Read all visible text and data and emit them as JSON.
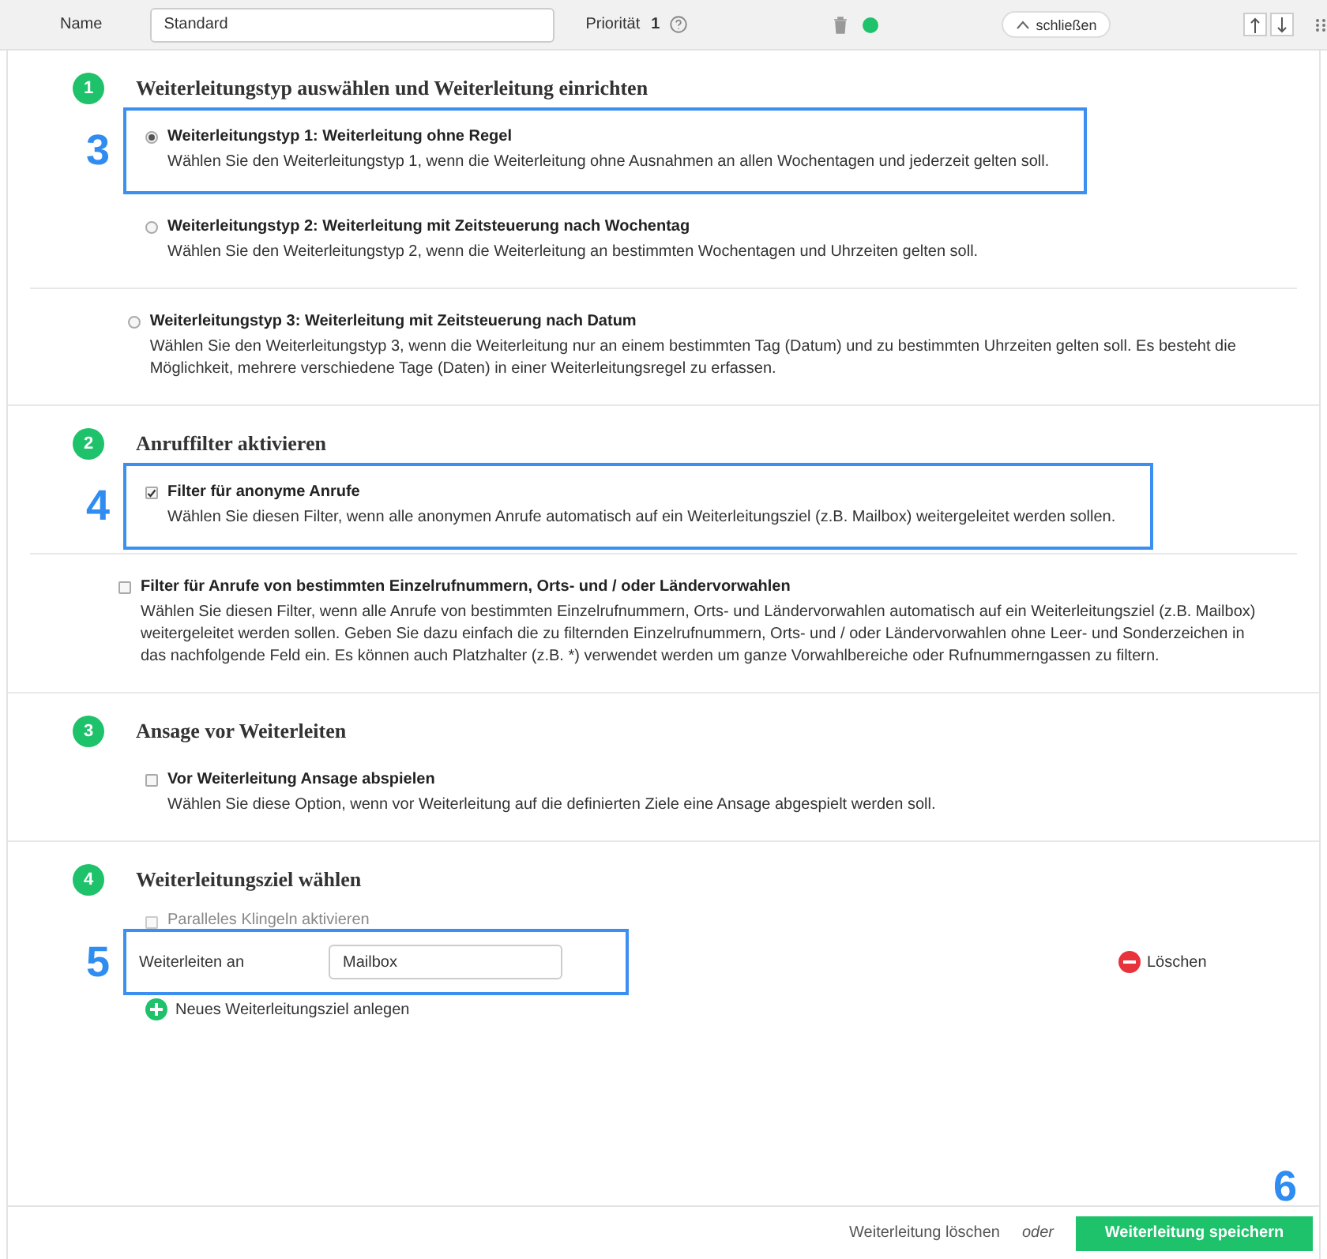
{
  "header": {
    "name_label": "Name",
    "name_value": "Standard",
    "priority_label": "Priorität",
    "priority_value": "1",
    "active": true,
    "close_label": "schließen"
  },
  "sections": [
    {
      "number": "1",
      "title": "Weiterleitungstyp auswählen und Weiterleitung einrichten",
      "options": [
        {
          "kind": "radio",
          "selected": true,
          "divider_above": false,
          "callout": "3",
          "title": "Weiterleitungstyp 1: Weiterleitung ohne Regel",
          "description": "Wählen Sie den Weiterleitungstyp 1, wenn die Weiterleitung ohne Ausnahmen an allen Wochentagen und jederzeit gelten soll."
        },
        {
          "kind": "radio",
          "selected": false,
          "divider_above": false,
          "title": "Weiterleitungstyp 2: Weiterleitung mit Zeitsteuerung nach Wochentag",
          "description": "Wählen Sie den Weiterleitungstyp 2, wenn die Weiterleitung an bestimmten Wochentagen und Uhrzeiten gelten soll."
        },
        {
          "kind": "radio",
          "selected": false,
          "divider_above": true,
          "title": "Weiterleitungstyp 3: Weiterleitung mit Zeitsteuerung nach Datum",
          "description": "Wählen Sie den Weiterleitungstyp 3, wenn die Weiterleitung nur an einem bestimmten Tag (Datum) und zu bestimmten Uhrzeiten gelten soll. Es besteht die Möglichkeit, mehrere verschiedene Tage (Daten) in einer Weiterleitungsregel zu erfassen."
        }
      ]
    },
    {
      "number": "2",
      "title": "Anruffilter aktivieren",
      "options": [
        {
          "kind": "checkbox",
          "checked": true,
          "divider_above": false,
          "callout": "4",
          "title": "Filter für anonyme Anrufe",
          "description": "Wählen Sie diesen Filter, wenn alle anonymen Anrufe automatisch auf ein Weiterleitungsziel (z.B. Mailbox) weitergeleitet werden sollen."
        },
        {
          "kind": "checkbox",
          "checked": false,
          "divider_above": true,
          "title": "Filter für Anrufe von bestimmten Einzelrufnummern, Orts- und / oder Ländervorwahlen",
          "description": "Wählen Sie diesen Filter, wenn alle Anrufe von bestimmten Einzelrufnummern, Orts- und Ländervorwahlen automatisch auf ein Weiterleitungsziel (z.B. Mailbox) weitergeleitet werden sollen. Geben Sie dazu einfach die zu filternden Einzelrufnummern, Orts- und / oder Ländervorwahlen ohne Leer- und Sonderzeichen in das nachfolgende Feld ein. Es können auch Platzhalter (z.B. *) verwendet werden um ganze Vorwahlbereiche oder Rufnummerngassen zu filtern."
        }
      ]
    },
    {
      "number": "3",
      "title": "Ansage vor Weiterleiten",
      "options": [
        {
          "kind": "checkbox",
          "checked": false,
          "divider_above": false,
          "title": "Vor Weiterleitung Ansage abspielen",
          "description": "Wählen Sie diese Option, wenn vor Weiterleitung auf die definierten Ziele eine Ansage abgespielt werden soll."
        }
      ]
    }
  ],
  "target_section": {
    "number": "4",
    "title": "Weiterleitungsziel wählen",
    "parallel": {
      "label": "Paralleles Klingeln aktivieren",
      "checked": false,
      "disabled": true
    },
    "targets": [
      {
        "label": "Weiterleiten an",
        "value": "Mailbox",
        "callout": "5",
        "delete_label": "Löschen"
      }
    ],
    "add_label": "Neues Weiterleitungsziel anlegen"
  },
  "footer": {
    "delete_label": "Weiterleitung löschen",
    "or_label": "oder",
    "save_label": "Weiterleitung speichern",
    "callout": "6"
  }
}
